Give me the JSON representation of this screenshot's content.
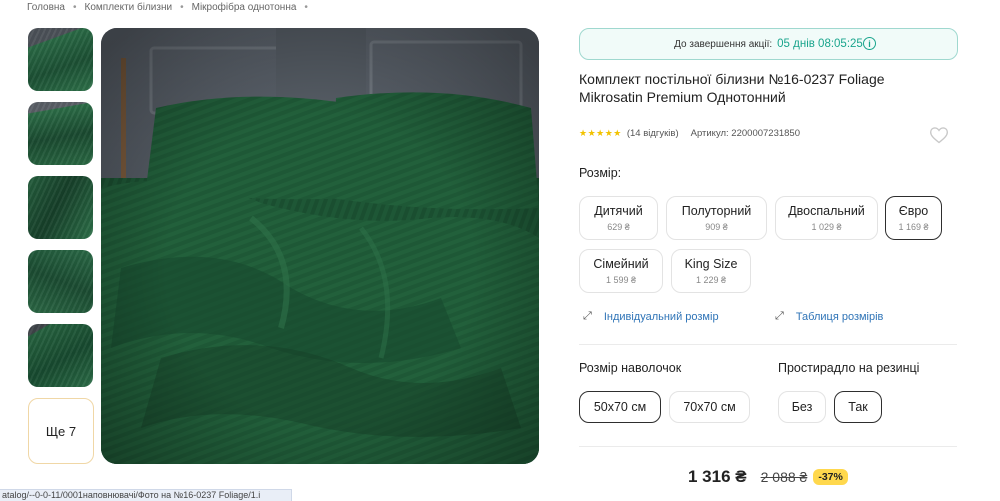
{
  "breadcrumb": [
    "Головна",
    "Комплекти білизни",
    "Мікрофібра однотонна"
  ],
  "gallery": {
    "more_label": "Ще 7"
  },
  "promo": {
    "label": "До завершення акції:",
    "timer": "05 днів 08:05:25"
  },
  "product": {
    "title": "Комплект постільної білизни №16-0237 Foliage Mikrosatin Premium Однотонний",
    "rating_stars": "★★★★★",
    "reviews": "(14 відгуків)",
    "article": "Артикул: 2200007231850"
  },
  "size": {
    "label": "Розмір:",
    "options": [
      {
        "name": "Дитячий",
        "price": "629 ₴"
      },
      {
        "name": "Полуторний",
        "price": "909 ₴"
      },
      {
        "name": "Двоспальний",
        "price": "1 029 ₴"
      },
      {
        "name": "Євро",
        "price": "1 169 ₴"
      },
      {
        "name": "Сімейний",
        "price": "1 599 ₴"
      },
      {
        "name": "King Size",
        "price": "1 229 ₴"
      }
    ],
    "selected": "Євро"
  },
  "links": {
    "individual": "Індивідуальний розмір",
    "size_table": "Таблиця розмірів"
  },
  "pillowcase": {
    "label": "Розмір наволочок",
    "options": [
      "50х70 см",
      "70х70 см"
    ],
    "selected": "50х70 см"
  },
  "sheet": {
    "label": "Простирадло на резинці",
    "options": [
      "Без",
      "Так"
    ],
    "selected": "Так"
  },
  "price": {
    "current": "1 316 ₴",
    "old": "2 088 ₴",
    "discount": "-37%"
  },
  "statusbar": {
    "url": "atalog/--0-0-11/0001наповнювачі/Фото на №16-0237 Foliage/1.i"
  },
  "colors": {
    "accent": "#1aa58d",
    "link": "#2f74b7",
    "discount_bg": "#ffd84d",
    "bedding": "#1f5a3a"
  }
}
